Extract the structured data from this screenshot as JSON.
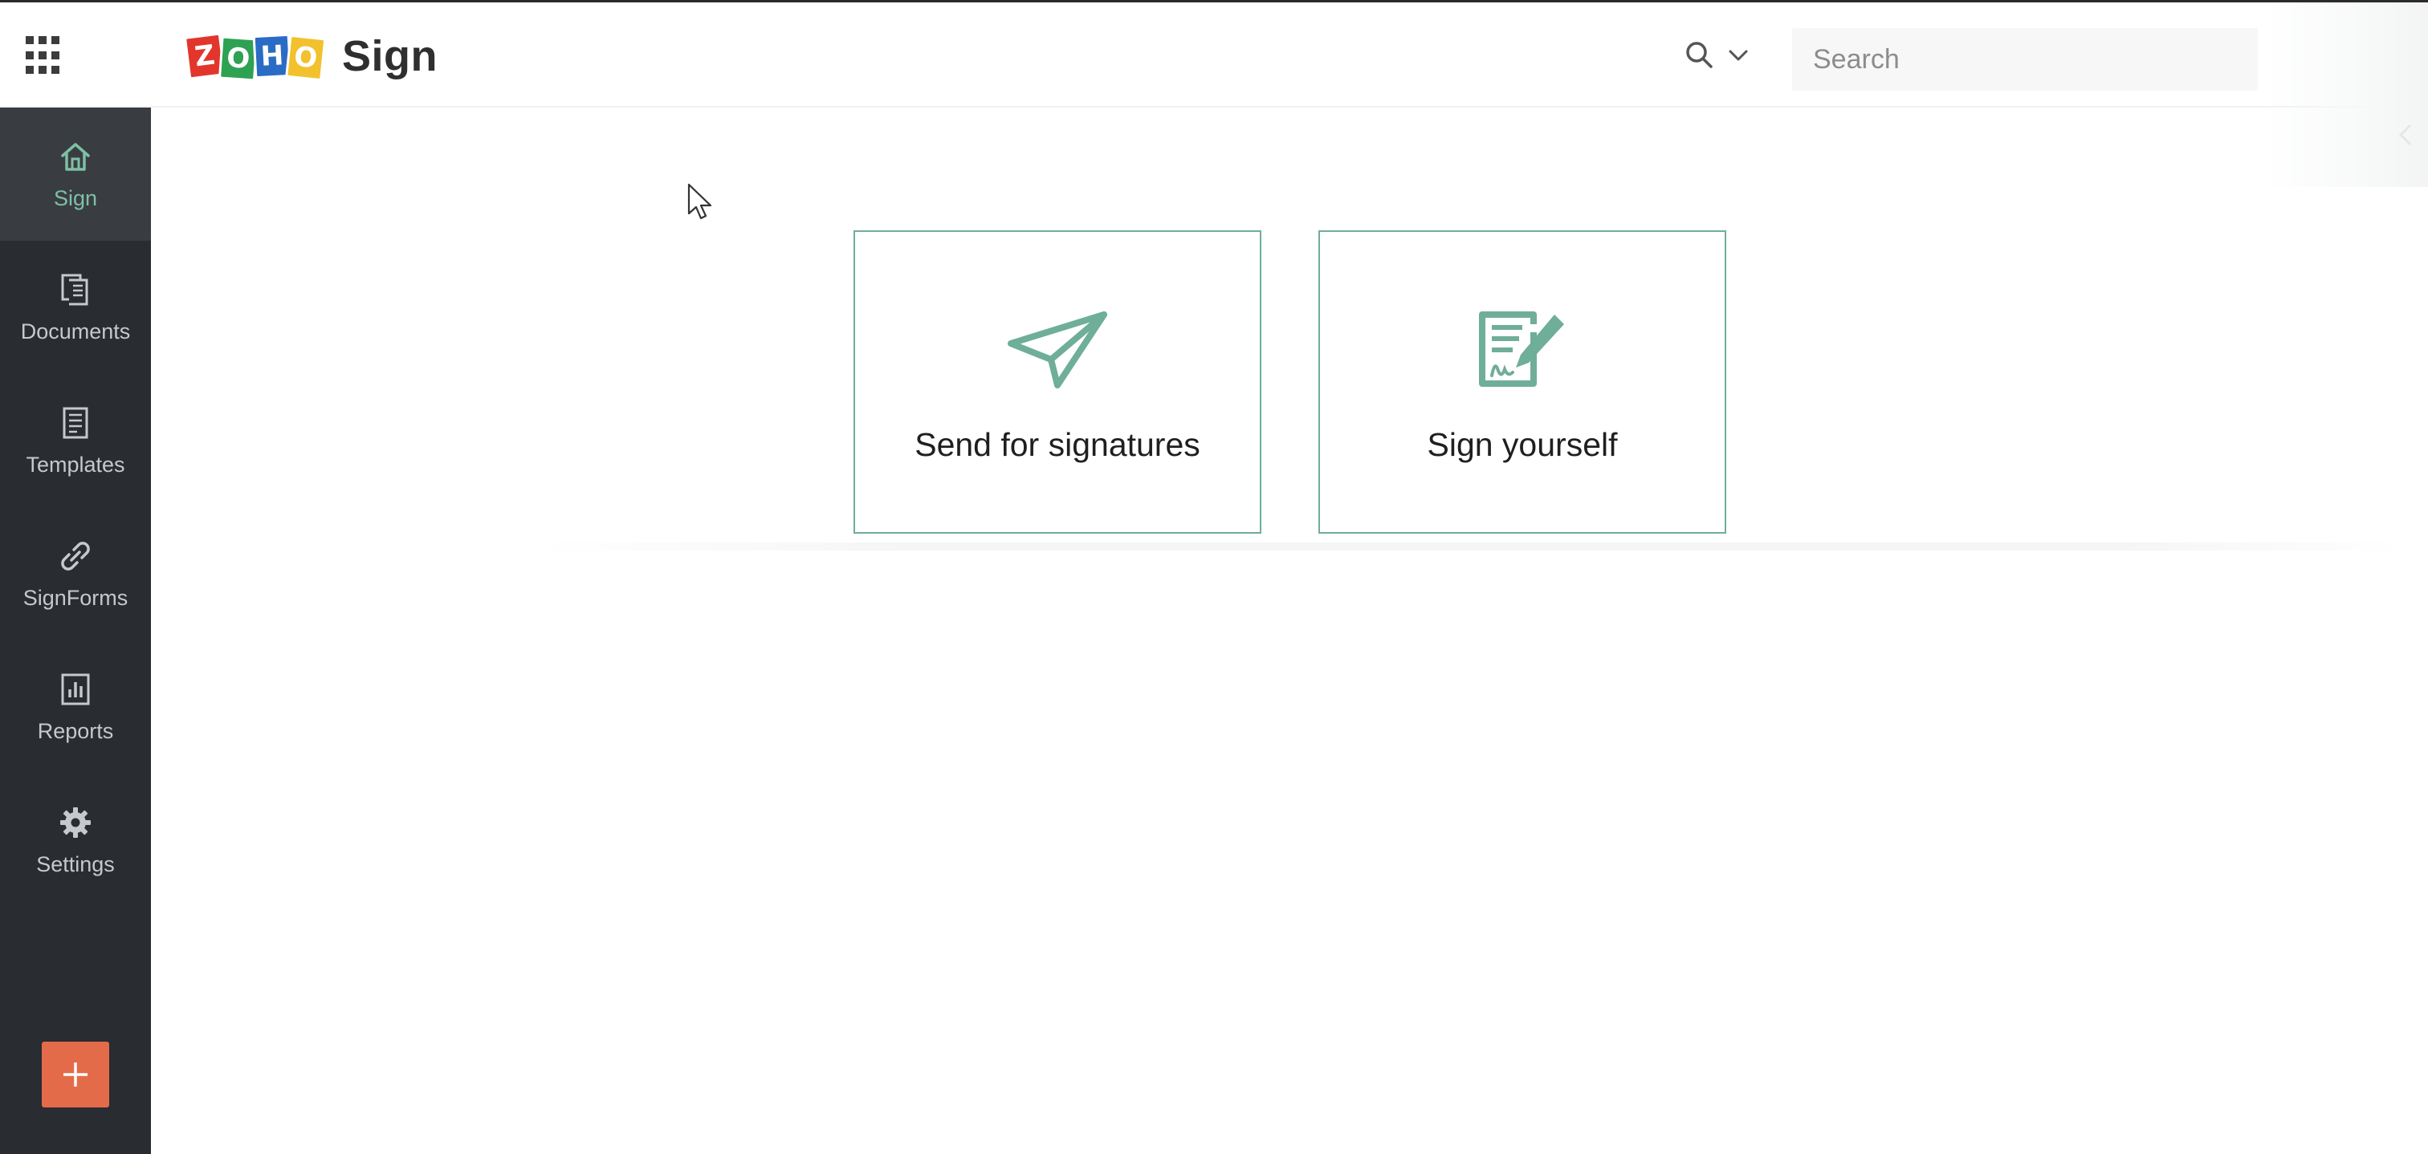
{
  "app": {
    "brand_letters": [
      "Z",
      "O",
      "H",
      "O"
    ],
    "brand_letter_colors": [
      "#e2362c",
      "#2ea153",
      "#2a6cc5",
      "#f2c12e"
    ],
    "product_name": "Sign"
  },
  "header": {
    "search_scope_icon": "search-icon",
    "search_scope_chevron": "chevron-down-icon",
    "search_placeholder": "Search"
  },
  "sidebar": {
    "items": [
      {
        "label": "Sign",
        "icon": "home-icon",
        "active": true
      },
      {
        "label": "Documents",
        "icon": "documents-icon",
        "active": false
      },
      {
        "label": "Templates",
        "icon": "templates-icon",
        "active": false
      },
      {
        "label": "SignForms",
        "icon": "link-icon",
        "active": false
      },
      {
        "label": "Reports",
        "icon": "reports-icon",
        "active": false
      },
      {
        "label": "Settings",
        "icon": "gear-icon",
        "active": false
      }
    ],
    "add_button_icon": "plus-icon"
  },
  "main": {
    "cards": [
      {
        "label": "Send for signatures",
        "icon": "paper-plane-icon"
      },
      {
        "label": "Sign yourself",
        "icon": "sign-document-icon"
      }
    ]
  },
  "colors": {
    "accent": "#6fae98",
    "sidebar_bg": "#292c30",
    "sidebar_active_bg": "#393d42",
    "add_button": "#e46b4a"
  }
}
